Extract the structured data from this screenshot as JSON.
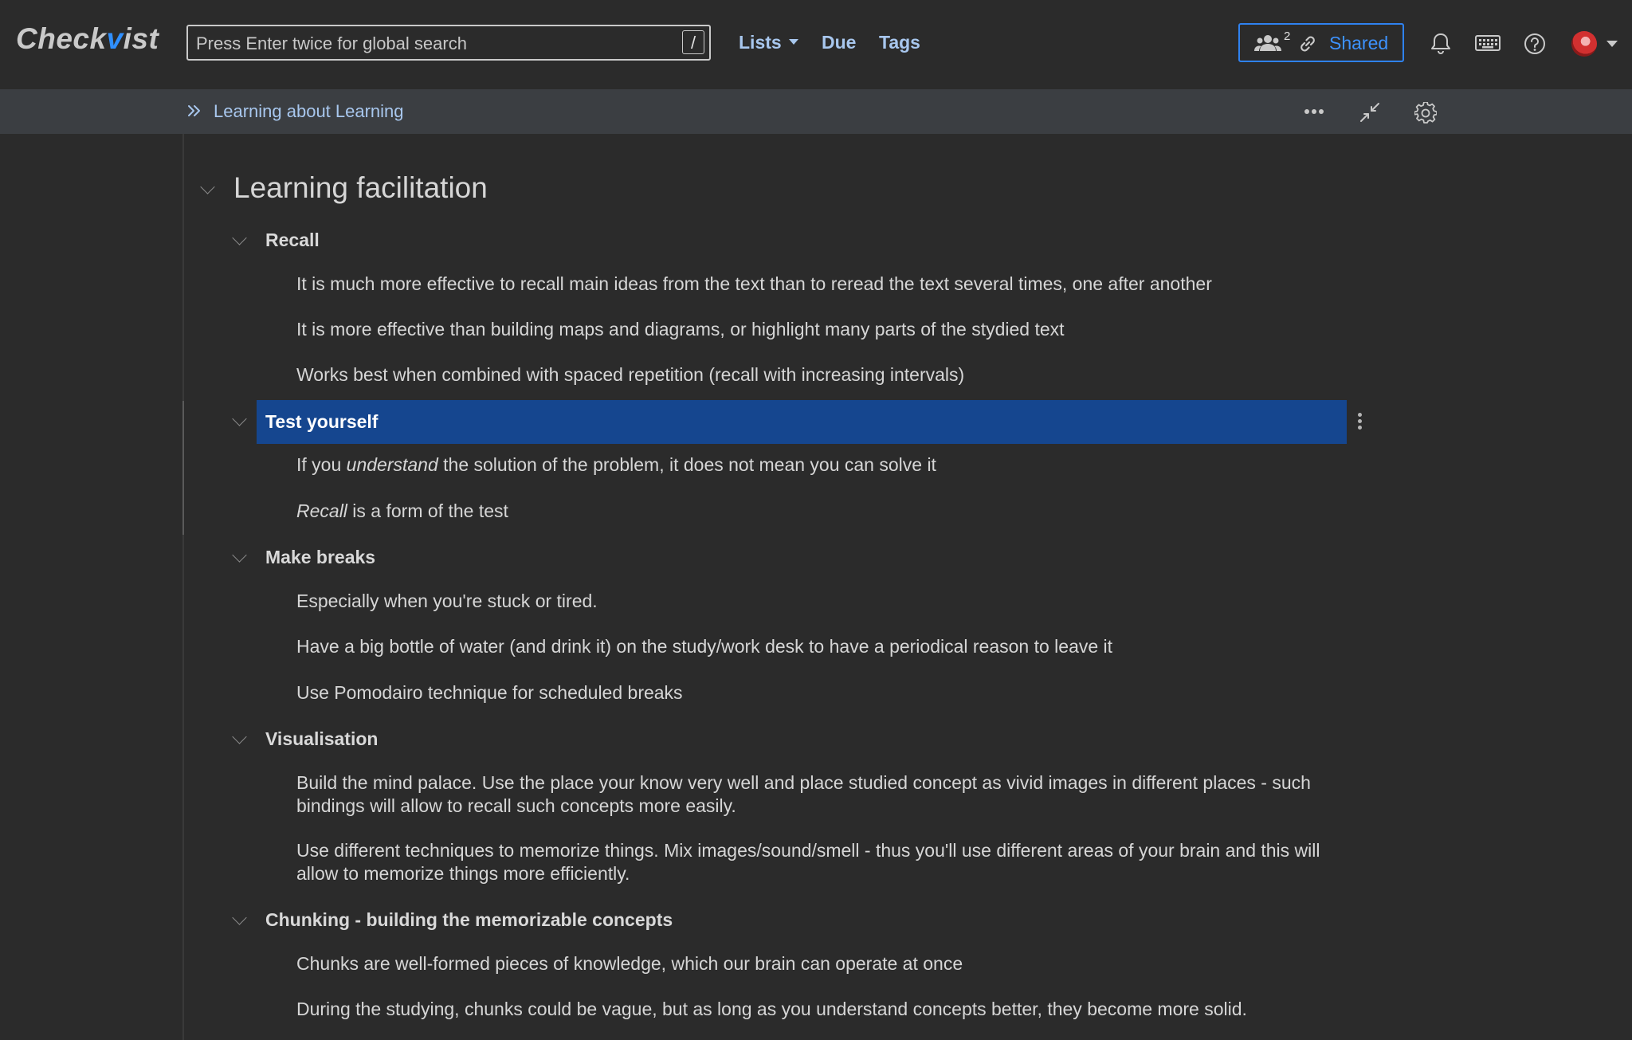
{
  "header": {
    "logo_prefix": "Check",
    "logo_v": "v",
    "logo_suffix": "ist",
    "search_placeholder": "Press Enter twice for global search",
    "search_shortcut": "/",
    "nav": {
      "lists": "Lists",
      "due": "Due",
      "tags": "Tags"
    },
    "shared": {
      "count": "2",
      "label": "Shared"
    },
    "icons": [
      "users-icon",
      "link-icon",
      "bell-icon",
      "keyboard-icon",
      "help-icon",
      "avatar"
    ]
  },
  "breadcrumb": {
    "label": "Learning about Learning",
    "icons": [
      "double-chevron-right-icon",
      "more-horizontal-icon",
      "collapse-icon",
      "gear-icon"
    ]
  },
  "list": {
    "title": "Learning facilitation",
    "groups": [
      {
        "label": "Recall",
        "items": [
          "It is much more effective to recall main ideas from the text than to reread the text several times, one after another",
          "It is more effective than building maps and diagrams, or highlight many parts of the stydied text",
          "Works best when combined with spaced repetition (recall with increasing intervals)"
        ]
      },
      {
        "label": "Test yourself",
        "selected": true,
        "items": [
          {
            "before": "If you ",
            "em": "understand",
            "after": " the solution of the problem, it does not mean you can solve it"
          },
          {
            "before": "",
            "em": "Recall",
            "after": " is a form of the test"
          }
        ]
      },
      {
        "label": "Make breaks",
        "items": [
          "Especially when you're stuck or tired.",
          "Have a big bottle of water (and drink it) on the study/work desk to have a periodical reason to leave it",
          "Use Pomodairo technique for scheduled breaks"
        ]
      },
      {
        "label": "Visualisation",
        "items": [
          "Build the mind palace. Use the place your know very well and place studied concept as vivid images in different places - such bindings will allow to recall such concepts more easily.",
          "Use different techniques to memorize things. Mix images/sound/smell - thus you'll use different areas of your brain and this will allow to memorize things more efficiently."
        ]
      },
      {
        "label": "Chunking - building the memorizable concepts",
        "items": [
          "Chunks are well-formed pieces of knowledge, which our brain can operate at once",
          "During the studying, chunks could be vague, but as long as you understand concepts better, they become more solid."
        ]
      }
    ]
  },
  "colors": {
    "background": "#2b2b2b",
    "breadcrumb_bar": "#3b3e42",
    "selection": "#15468f",
    "accent": "#2f82f0",
    "link_text": "#a8c7ee"
  }
}
